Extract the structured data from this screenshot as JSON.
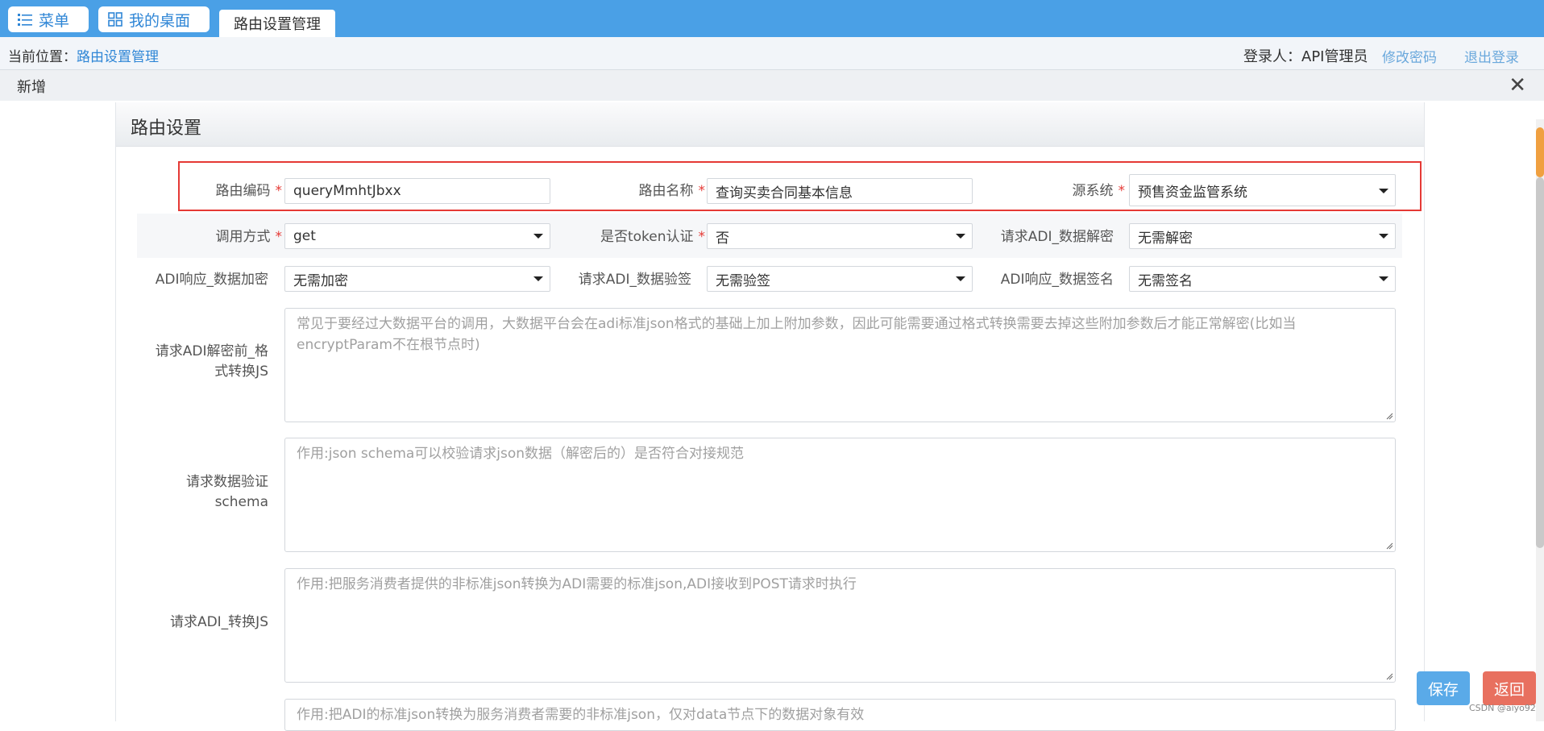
{
  "topnav": {
    "menu_label": "菜单",
    "desktop_label": "我的桌面",
    "active_tab": "路由设置管理"
  },
  "breadcrumb": {
    "prefix": "当前位置：",
    "current": "路由设置管理"
  },
  "user": {
    "login_text": "登录人：API管理员",
    "change_password": "修改密码",
    "logout": "退出登录"
  },
  "dialog": {
    "title": "新增",
    "close_icon": "close-icon"
  },
  "panel": {
    "title": "路由设置"
  },
  "form": {
    "route_code": {
      "label": "路由编码",
      "required": "*",
      "value": "queryMmhtJbxx"
    },
    "route_name": {
      "label": "路由名称",
      "required": "*",
      "value": "查询买卖合同基本信息"
    },
    "source_system": {
      "label": "源系统",
      "required": "*",
      "value": "预售资金监管系统"
    },
    "call_method": {
      "label": "调用方式",
      "required": "*",
      "value": "get"
    },
    "token_auth": {
      "label": "是否token认证",
      "required": "*",
      "value": "否"
    },
    "req_decrypt": {
      "label": "请求ADI_数据解密",
      "value": "无需解密"
    },
    "resp_encrypt": {
      "label": "ADI响应_数据加密",
      "value": "无需加密"
    },
    "req_verify": {
      "label": "请求ADI_数据验签",
      "value": "无需验签"
    },
    "resp_sign": {
      "label": "ADI响应_数据签名",
      "value": "无需签名"
    },
    "pre_decrypt_js": {
      "label_line1": "请求ADI解密前_格",
      "label_line2": "式转换JS",
      "placeholder": "常见于要经过大数据平台的调用，大数据平台会在adi标准json格式的基础上加上附加参数，因此可能需要通过格式转换需要去掉这些附加参数后才能正常解密(比如当encryptParam不在根节点时)"
    },
    "req_schema": {
      "label_line1": "请求数据验证",
      "label_line2": "schema",
      "placeholder": "作用:json schema可以校验请求json数据（解密后的）是否符合对接规范"
    },
    "req_convert_js": {
      "label": "请求ADI_转换JS",
      "placeholder": "作用:把服务消费者提供的非标准json转换为ADI需要的标准json,ADI接收到POST请求时执行"
    },
    "resp_convert_js": {
      "placeholder": "作用:把ADI的标准json转换为服务消费者需要的非标准json，仅对data节点下的数据对象有效"
    }
  },
  "actions": {
    "save": "保存",
    "back": "返回",
    "save_color": "#5aaae8",
    "back_color": "#e8705f"
  },
  "watermark": "CSDN @aiyo92"
}
